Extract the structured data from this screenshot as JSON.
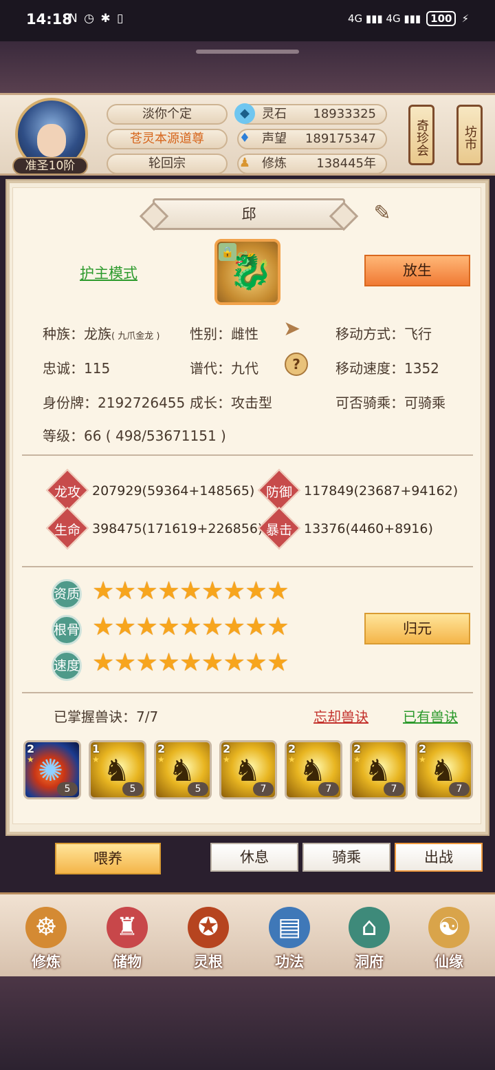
{
  "status_bar": {
    "time": "14:18",
    "sys_icons": "N ◷ ✱ ▯",
    "signal": "4G ▮▮▮ 4G ▮▮▮",
    "battery": "100"
  },
  "header": {
    "rank": "准圣10阶",
    "plates": [
      "淡你个定",
      "苍灵本源道尊",
      "轮回宗"
    ],
    "resources": [
      {
        "icon": "spirit-stone-icon",
        "label": "灵石",
        "value": "18933325"
      },
      {
        "icon": "prestige-icon",
        "label": "声望",
        "value": "189175347"
      },
      {
        "icon": "cultivation-icon",
        "label": "修炼",
        "value": "138445年"
      }
    ],
    "scroll_buttons": [
      "奇珍会",
      "坊市"
    ]
  },
  "pet": {
    "name": "邱",
    "mode": "护主模式",
    "release_label": "放生",
    "info": {
      "race_label": "种族：",
      "race": "龙族",
      "race_sub": "( 九爪金龙 )",
      "gender_label": "性别：",
      "gender": "雌性",
      "move_label": "移动方式：",
      "move": "飞行",
      "loyalty_label": "忠诚：",
      "loyalty": "115",
      "gen_label": "谱代：",
      "gen": "九代",
      "speed_label": "移动速度：",
      "speed": "1352",
      "id_label": "身份牌：",
      "id": "2192726455",
      "growth_label": "成长：",
      "growth": "攻击型",
      "ride_label": "可否骑乘：",
      "ride": "可骑乘",
      "level_label": "等级：",
      "level": "66 ( 498/53671151 )"
    }
  },
  "stats": [
    {
      "label": "龙攻",
      "value": "207929(59364+148565)"
    },
    {
      "label": "防御",
      "value": "117849(23687+94162)"
    },
    {
      "label": "生命",
      "value": "398475(171619+226856)"
    },
    {
      "label": "暴击",
      "value": "13376(4460+8916)"
    }
  ],
  "talents": [
    {
      "label": "资质",
      "stars": 9,
      "stars_text": "★★★★★★★★★"
    },
    {
      "label": "根骨",
      "stars": 9,
      "stars_text": "★★★★★★★★★"
    },
    {
      "label": "速度",
      "stars": 9,
      "stars_text": "★★★★★★★★★"
    }
  ],
  "restore_label": "归元",
  "skills": {
    "mastered": "已掌握兽诀：7/7",
    "forget": "忘却兽诀",
    "owned": "已有兽诀",
    "items": [
      {
        "level": "2",
        "count": "5",
        "type": "fire"
      },
      {
        "level": "1",
        "count": "5",
        "type": "gold"
      },
      {
        "level": "2",
        "count": "5",
        "type": "gold"
      },
      {
        "level": "2",
        "count": "7",
        "type": "gold"
      },
      {
        "level": "2",
        "count": "7",
        "type": "gold"
      },
      {
        "level": "2",
        "count": "7",
        "type": "gold"
      },
      {
        "level": "2",
        "count": "7",
        "type": "gold"
      }
    ]
  },
  "actions": {
    "feed": "喂养",
    "rest": "休息",
    "ride": "骑乘",
    "battle": "出战"
  },
  "nav": [
    {
      "label": "修炼",
      "icon": "meditate-icon"
    },
    {
      "label": "储物",
      "icon": "bag-icon"
    },
    {
      "label": "灵根",
      "icon": "spirit-root-icon"
    },
    {
      "label": "功法",
      "icon": "book-icon"
    },
    {
      "label": "洞府",
      "icon": "mansion-icon"
    },
    {
      "label": "仙缘",
      "icon": "gourd-icon"
    }
  ],
  "colors": {
    "accent_orange": "#f07a34",
    "green_link": "#2c9a2c",
    "red_link": "#c3322d",
    "star": "#f7a51d"
  }
}
